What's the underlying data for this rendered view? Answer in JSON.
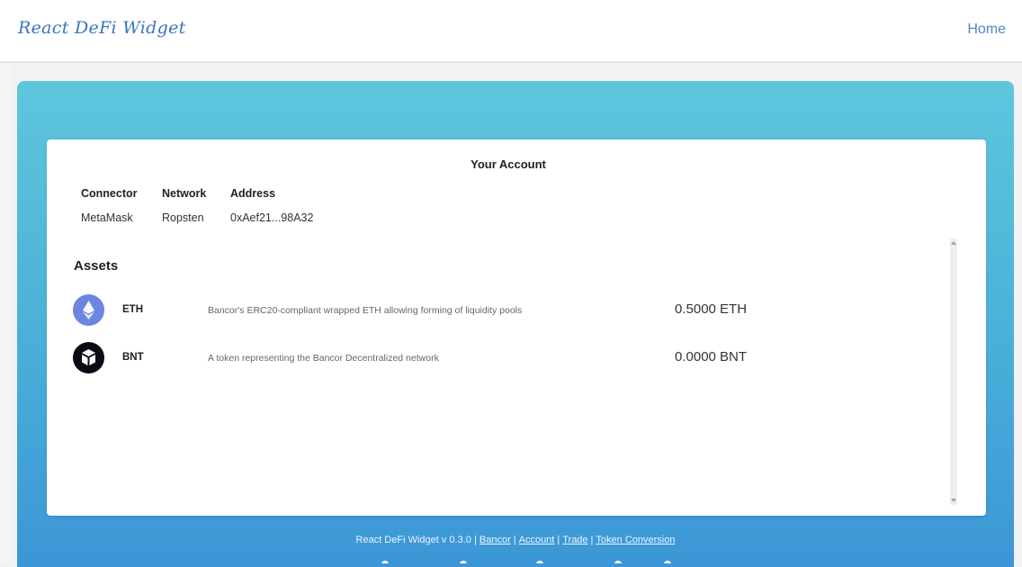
{
  "navbar": {
    "brand": "React DeFi Widget",
    "home_link": "Home"
  },
  "account": {
    "title": "Your Account",
    "headers": [
      "Connector",
      "Network",
      "Address"
    ],
    "values": [
      "MetaMask",
      "Ropsten",
      "0xAef21...98A32"
    ]
  },
  "assets": {
    "title": "Assets",
    "items": [
      {
        "icon": "eth-token-icon",
        "symbol": "ETH",
        "description": "Bancor's ERC20-compliant wrapped ETH allowing forming of liquidity pools",
        "balance": "0.5000 ETH",
        "color": "#6a86e0"
      },
      {
        "icon": "bnt-token-icon",
        "symbol": "BNT",
        "description": "A token representing the Bancor Decentralized network",
        "balance": "0.0000 BNT",
        "color": "#0b0c13"
      }
    ]
  },
  "footer": {
    "prefix": "React DeFi Widget v 0.3.0 |",
    "links": [
      "Bancor",
      "Account",
      "Trade",
      "Token Conversion"
    ]
  },
  "colors": {
    "brand": "#3a73c2",
    "hero_top": "#5ec6dc",
    "hero_bottom": "#3c96d6"
  }
}
